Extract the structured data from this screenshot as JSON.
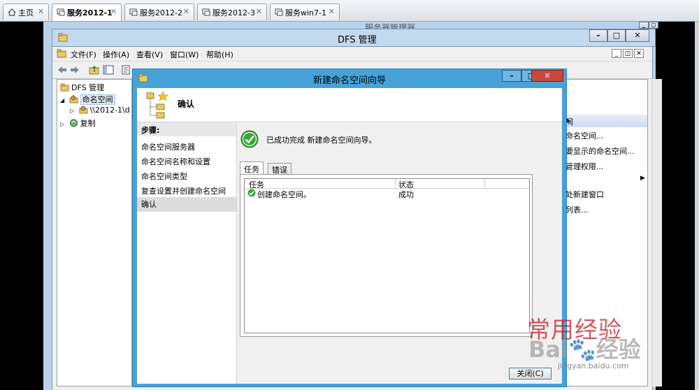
{
  "browser": {
    "tabs": [
      {
        "label": "主页",
        "icon": "home-icon",
        "active": false
      },
      {
        "label": "服务2012-1",
        "icon": "remote-desktop-icon",
        "active": true
      },
      {
        "label": "服务2012-2",
        "icon": "remote-desktop-icon",
        "active": false
      },
      {
        "label": "服务2012-3",
        "icon": "remote-desktop-icon",
        "active": false
      },
      {
        "label": "服务win7-1",
        "icon": "remote-desktop-icon",
        "active": false
      }
    ],
    "close_glyph": "✕"
  },
  "background_window_title": "服务器管理器",
  "dfs": {
    "title": "DFS 管理",
    "menu": [
      "文件(F)",
      "操作(A)",
      "查看(V)",
      "窗口(W)",
      "帮助(H)"
    ],
    "tree": {
      "root": "DFS 管理",
      "namespaces": "命名空间",
      "namespace_item": "\\\\2012-1\\d",
      "replication": "复制"
    },
    "actions": {
      "header": "间",
      "items": [
        "命名空间...",
        "要显示的命名空间...",
        "管理权限...",
        "处新建窗口",
        "列表..."
      ]
    }
  },
  "wizard": {
    "title": "新建命名空间向导",
    "page_title": "确认",
    "steps_header": "步骤:",
    "steps": [
      "命名空间服务器",
      "命名空间名称和设置",
      "命名空间类型",
      "复查设置并创建命名空间",
      "确认"
    ],
    "current_step_index": 4,
    "success_message": "已成功完成 新建命名空间向导。",
    "tabs": [
      "任务",
      "错误"
    ],
    "grid": {
      "columns": [
        "任务",
        "状态"
      ],
      "rows": [
        {
          "task": "创建命名空间。",
          "status": "成功"
        }
      ]
    },
    "close_button": "关闭(C)"
  },
  "watermark": {
    "text": "常用经验",
    "brand": "Bai",
    "brand2": "经验",
    "url": "jingyan.baidu.com"
  },
  "colors": {
    "wizard_frame": "#46a2d8",
    "close_red": "#c9483c",
    "success_green": "#3aa63a"
  }
}
